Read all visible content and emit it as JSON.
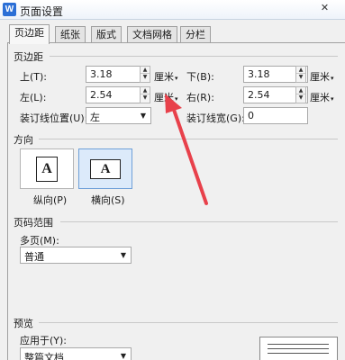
{
  "window": {
    "title": "页面设置",
    "app_icon": "W",
    "close_icon_glyph": "✕"
  },
  "tabs": [
    {
      "label": "页边距",
      "active": true
    },
    {
      "label": "纸张"
    },
    {
      "label": "版式"
    },
    {
      "label": "文档网格"
    },
    {
      "label": "分栏"
    }
  ],
  "margins": {
    "section_label": "页边距",
    "top": {
      "label": "上(T):",
      "value": "3.18",
      "unit": "厘米"
    },
    "bottom": {
      "label": "下(B):",
      "value": "3.18",
      "unit": "厘米"
    },
    "left": {
      "label": "左(L):",
      "value": "2.54",
      "unit": "厘米"
    },
    "right": {
      "label": "右(R):",
      "value": "2.54",
      "unit": "厘米"
    },
    "gutter_position": {
      "label": "装订线位置(U):",
      "value": "左"
    },
    "gutter_width": {
      "label": "装订线宽(G):",
      "value": "0"
    }
  },
  "orientation": {
    "section_label": "方向",
    "portrait": {
      "label": "纵向(P)",
      "glyph": "A",
      "selected": false
    },
    "landscape": {
      "label": "横向(S)",
      "glyph": "A",
      "selected": true
    }
  },
  "page_range": {
    "section_label": "页码范围",
    "multiple_pages": {
      "label": "多页(M):",
      "value": "普通"
    }
  },
  "preview": {
    "section_label": "预览",
    "apply_to": {
      "label": "应用于(Y):",
      "value": "整篇文档"
    }
  },
  "annotation": {
    "arrow_color": "#e8414b"
  },
  "icons": {
    "spin_up": "▲",
    "spin_down": "▼",
    "dropdown": "▼",
    "unit_caret": "▾"
  }
}
